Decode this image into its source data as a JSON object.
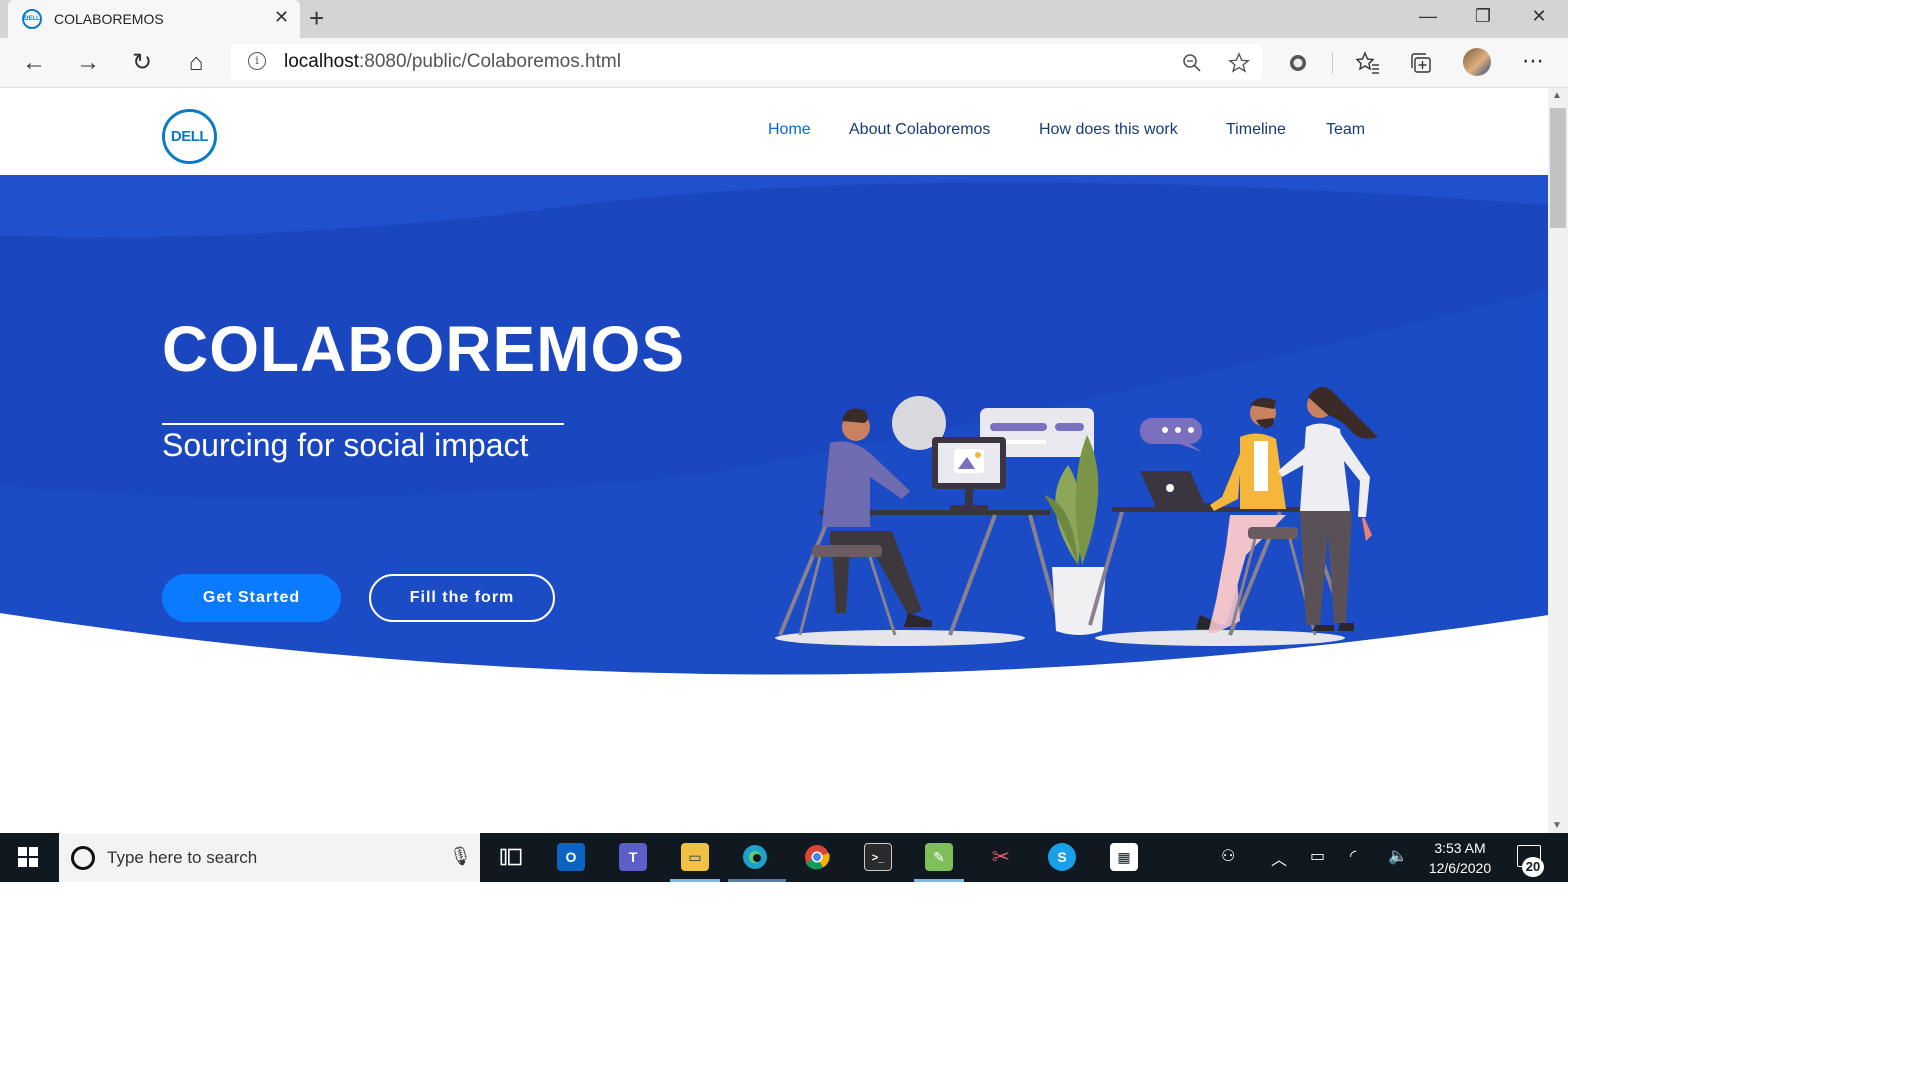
{
  "browser": {
    "tab_title": "COLABOREMOS",
    "favicon_text": "DELL",
    "tab_close": "✕",
    "new_tab": "+",
    "url_host": "localhost",
    "url_rest": ":8080/public/Colaboremos.html",
    "window_controls": {
      "minimize": "—",
      "restore": "❐",
      "close": "✕"
    },
    "nav_icons": {
      "back": "←",
      "forward": "→",
      "refresh": "↻",
      "home": "⌂"
    }
  },
  "site": {
    "logo_text": "DELL",
    "nav": [
      {
        "label": "Home",
        "active": true
      },
      {
        "label": "About Colaboremos"
      },
      {
        "label": "How does this work"
      },
      {
        "label": "Timeline"
      },
      {
        "label": "Team"
      }
    ],
    "hero": {
      "title": "COLABOREMOS",
      "subtitle": "Sourcing for social impact",
      "primary_button": "Get Started",
      "secondary_button": "Fill the form"
    }
  },
  "taskbar": {
    "search_placeholder": "Type here to search",
    "time": "3:53 AM",
    "date": "12/6/2020",
    "notification_count": "20",
    "apps": [
      "task-view",
      "outlook",
      "teams",
      "file-explorer",
      "edge",
      "chrome",
      "terminal",
      "paint",
      "snip",
      "skype",
      "store"
    ]
  },
  "colors": {
    "hero_blue": "#1a47c0",
    "hero_blue_light": "#2457d4",
    "button_blue": "#0a7bff",
    "nav_text": "#173b77",
    "brand": "#0a7bc5"
  }
}
